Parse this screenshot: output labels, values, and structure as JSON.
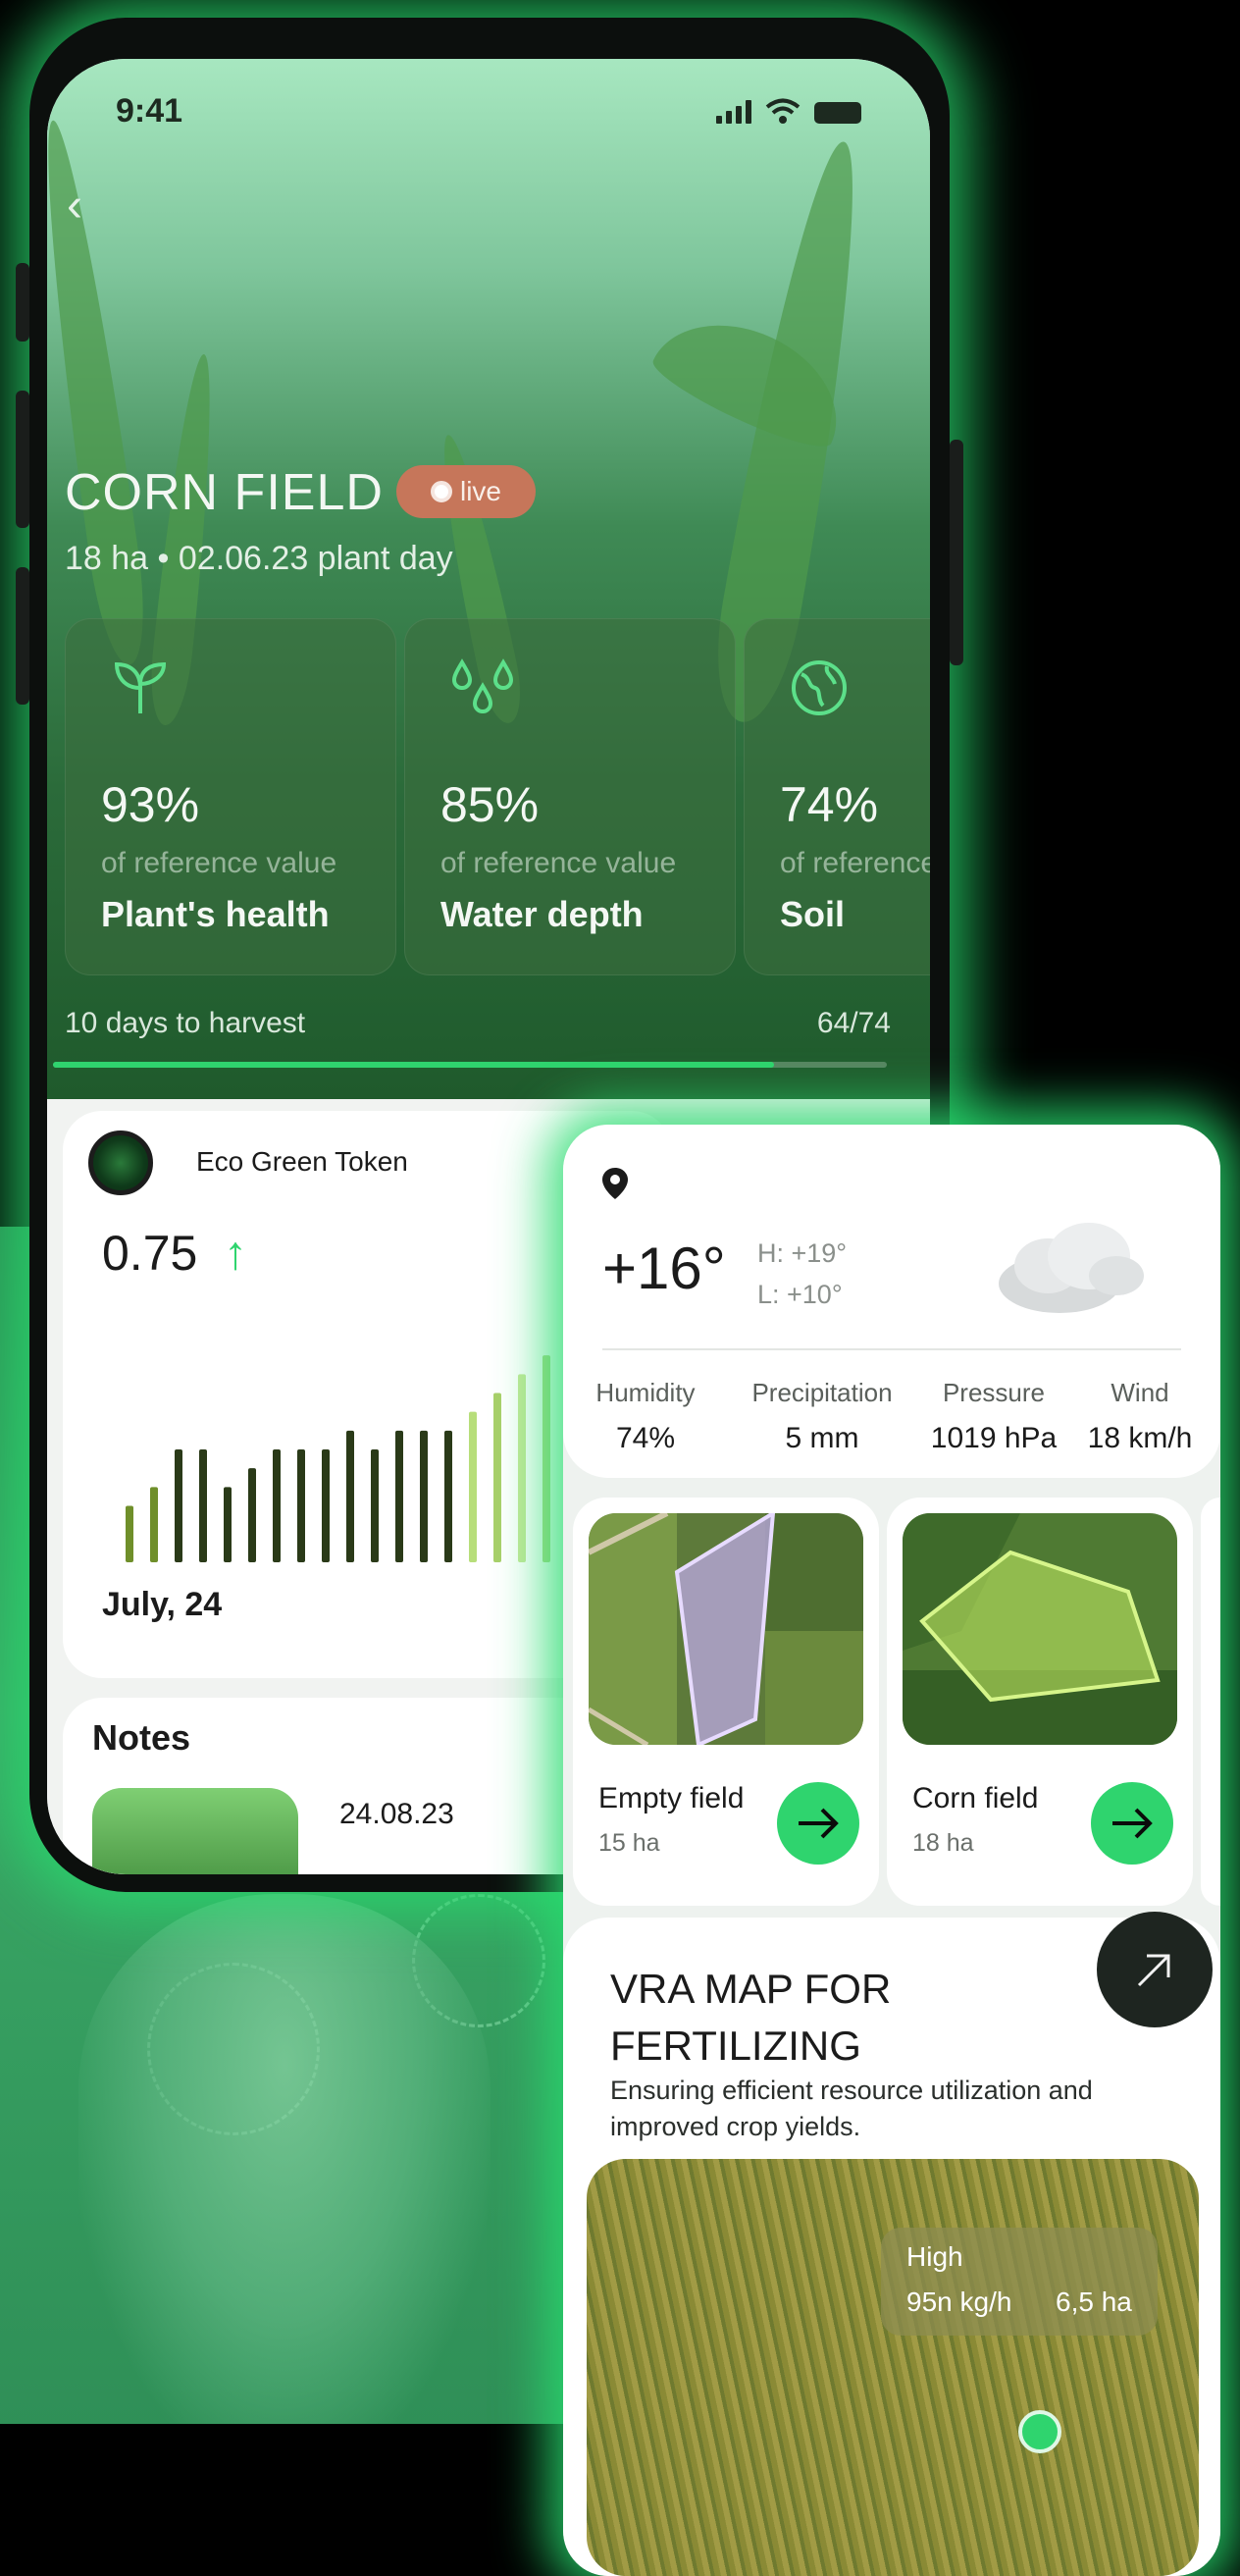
{
  "status_bar": {
    "time": "9:41"
  },
  "field": {
    "title": "CORN FIELD",
    "live_label": "live",
    "subtitle": "18 ha  •  02.06.23 plant day"
  },
  "metrics": [
    {
      "value": "93%",
      "ref": "of reference value",
      "label": "Plant's health",
      "icon": "sprout-icon"
    },
    {
      "value": "85%",
      "ref": "of reference value",
      "label": "Water depth",
      "icon": "water-drops-icon"
    },
    {
      "value": "74%",
      "ref": "of reference value",
      "label": "Soil",
      "icon": "globe-icon"
    }
  ],
  "harvest": {
    "text": "10 days to harvest",
    "count": "64/74",
    "progress": 0.865
  },
  "token": {
    "name": "Eco Green Token",
    "value": "0.75",
    "date": "July, 24",
    "bars": [
      3,
      4,
      6,
      6,
      4,
      5,
      6,
      6,
      6,
      7,
      6,
      7,
      7,
      7,
      8,
      9,
      10,
      11,
      12
    ]
  },
  "notes": {
    "title": "Notes",
    "first_date": "24.08.23"
  },
  "weather": {
    "temp": "+16°",
    "high": "H: +19°",
    "low": "L: +10°",
    "stats": [
      {
        "label": "Humidity",
        "value": "74%"
      },
      {
        "label": "Precipitation",
        "value": "5 mm"
      },
      {
        "label": "Pressure",
        "value": "1019 hPa"
      },
      {
        "label": "Wind",
        "value": "18 km/h"
      }
    ]
  },
  "fields": [
    {
      "name": "Empty field",
      "size": "15 ha"
    },
    {
      "name": "Corn field",
      "size": "18 ha"
    }
  ],
  "vra": {
    "title": "VRA MAP FOR FERTILIZING",
    "desc": "Ensuring efficient resource utilization and improved crop yields.",
    "tooltip": {
      "level": "High",
      "rate": "95n kg/h",
      "area": "6,5 ha"
    }
  },
  "colors": {
    "accent": "#2fd46e",
    "live": "#c6765a",
    "dark": "#1e2520"
  }
}
